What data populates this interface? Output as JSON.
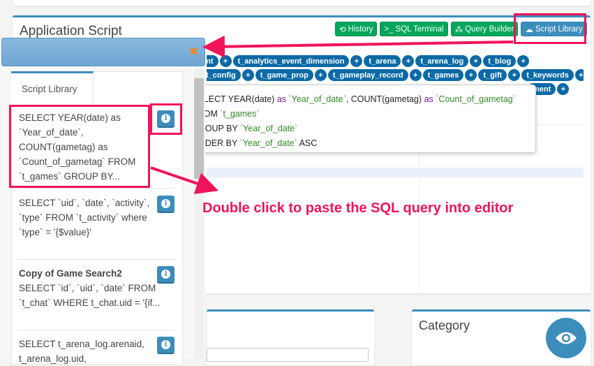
{
  "page": {
    "title": "Application Script"
  },
  "toolbar": {
    "history": "History",
    "sql_terminal": "SQL Terminal",
    "query_builder": "Query Builder",
    "script_library": "Script Library"
  },
  "tables": {
    "row1": [
      "ent",
      "t_analytics_event_dimension",
      "t_arena",
      "t_arena_log",
      "t_blog"
    ],
    "row2": [
      "t_config",
      "t_game_prop",
      "t_gameplay_record",
      "t_games",
      "t_gift",
      "t_keywords"
    ],
    "row3": [
      "ment"
    ],
    "add_symbol": "+"
  },
  "tooltip": {
    "l1a": "SELECT YEAR(date) ",
    "l1b": "as",
    "l1c": " `Year_of_date`",
    "l1d": ", COUNT(gametag) ",
    "l1e": "as",
    "l1f": " `Count_of_gametag`",
    "l2a": "FROM ",
    "l2b": "`t_games`",
    "l3a": "GROUP BY ",
    "l3b": "`Year_of_date`",
    "l4a": "ORDER BY ",
    "l4b": "`Year_of_date`",
    "l4c": " ASC"
  },
  "library": {
    "tab": "Script Library",
    "items": [
      {
        "title": "",
        "text": "SELECT YEAR(date) as `Year_of_date`, COUNT(gametag) as `Count_of_gametag` FROM `t_games` GROUP BY..."
      },
      {
        "title": "",
        "text": "SELECT `uid`, `date`, `activity`, `type` FROM `t_activity` where `type` = '{$value}'"
      },
      {
        "title": "Copy of Game Search2",
        "text": "SELECT `id`, `uid`, `date` FROM `t_chat` WHERE t_chat.uid = '{if..."
      },
      {
        "title": "",
        "text": "SELECT t_arena_log.arenaid, t_arena_log.uid,"
      }
    ]
  },
  "annotation": "Double click to paste the SQL query into editor",
  "category": {
    "title": "Category"
  },
  "colors": {
    "accent": "#3c8dbc",
    "green": "#00a65a",
    "highlight": "#f0145a",
    "tag": "#0b6aa6"
  }
}
